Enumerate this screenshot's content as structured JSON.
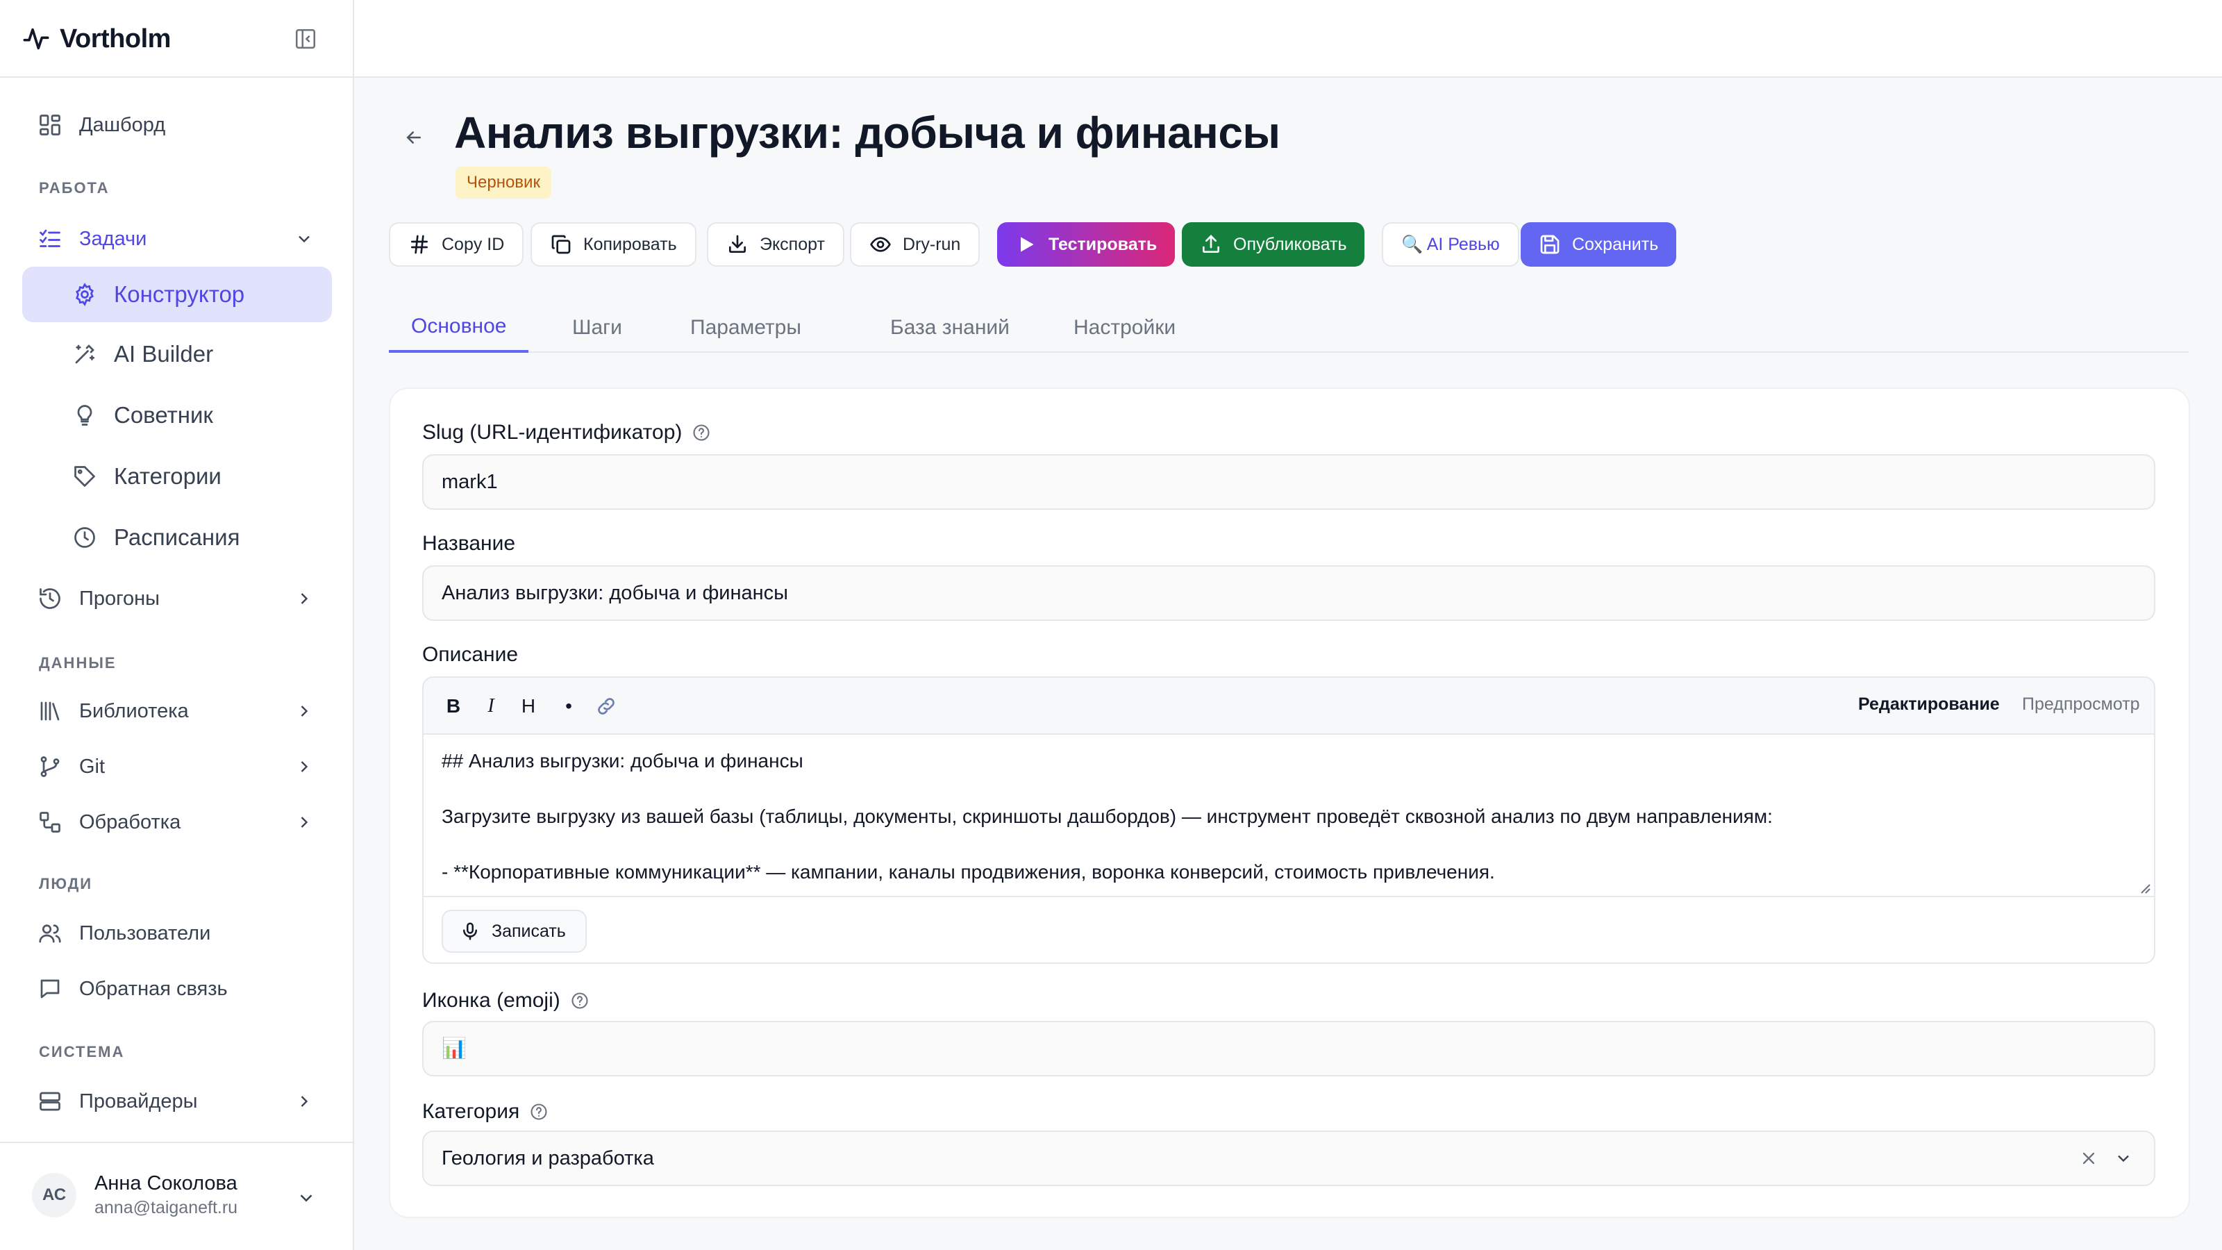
{
  "app": {
    "name": "Vortholm"
  },
  "sidebar": {
    "dashboard": "Дашборд",
    "sections": {
      "work": "РАБОТА",
      "data": "ДАННЫЕ",
      "people": "ЛЮДИ",
      "system": "СИСТЕМА"
    },
    "tasks": "Задачи",
    "task_children": [
      "Конструктор",
      "AI Builder",
      "Советник",
      "Категории",
      "Расписания"
    ],
    "runs": "Прогоны",
    "library": "Библиотека",
    "git": "Git",
    "processing": "Обработка",
    "users": "Пользователи",
    "feedback": "Обратная связь",
    "providers": "Провайдеры"
  },
  "user": {
    "initials": "АС",
    "name": "Анна Соколова",
    "email": "anna@taiganeft.ru"
  },
  "header": {
    "title": "Анализ выгрузки: добыча и финансы",
    "status": "Черновик"
  },
  "toolbar": {
    "copy_id": "Copy ID",
    "copy": "Копировать",
    "export": "Экспорт",
    "dry_run": "Dry-run",
    "test": "Тестировать",
    "publish": "Опубликовать",
    "ai_review": "🔍 AI Ревью",
    "save": "Сохранить"
  },
  "tabs": [
    "Основное",
    "Шаги",
    "Параметры",
    "База знаний",
    "Настройки"
  ],
  "form": {
    "slug_label": "Slug (URL-идентификатор)",
    "slug_value": "mark1",
    "name_label": "Название",
    "name_value": "Анализ выгрузки: добыча и финансы",
    "description_label": "Описание",
    "editor_tools": [
      "B",
      "I",
      "H",
      "•"
    ],
    "mode_edit": "Редактирование",
    "mode_preview": "Предпросмотр",
    "description_lines": [
      "## Анализ выгрузки: добыча и финансы",
      "Загрузите выгрузку из вашей базы (таблицы, документы, скриншоты дашбордов) — инструмент проведёт сквозной анализ по двум направлениям:",
      "- **Корпоративные коммуникации** — кампании, каналы продвижения, воронка конверсий, стоимость привлечения."
    ],
    "record": "Записать",
    "icon_label": "Иконка (emoji)",
    "icon_value": "📊",
    "category_label": "Категория",
    "category_value": "Геология и разработка"
  },
  "colors": {
    "accent": "#4f46e5",
    "active_bg": "#e0e3fb",
    "publish": "#15803d",
    "draft_bg": "#fef3c7"
  }
}
